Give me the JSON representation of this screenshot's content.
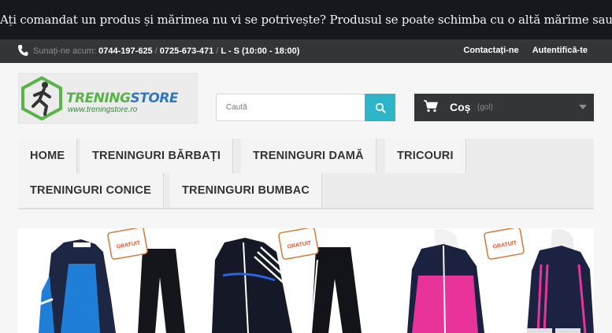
{
  "banner": {
    "text": "Ați comandat un produs și mărimea nu vi se potrivește? Produsul se poate schimba cu o altă mărime sau orice alt produs din stoc!"
  },
  "topbar": {
    "call_label": "Sunați-ne acum:",
    "phone1": "0744-197-625",
    "phone2": "0725-673-471",
    "hours": "L - S (10:00 - 18:00)",
    "links": [
      "Contactați-ne",
      "Autentifică-te"
    ]
  },
  "logo": {
    "brand_a": "TRENING",
    "brand_b": "STORE",
    "url": "www.treningstore.ro"
  },
  "search": {
    "placeholder": "Caută"
  },
  "cart": {
    "label": "Coș",
    "status": "(gol)"
  },
  "nav": {
    "items": [
      "HOME",
      "TRENINGURI BĂRBAȚI",
      "TRENINGURI DAMĂ",
      "TRICOURI",
      "TRENINGURI CONICE",
      "TRENINGURI BUMBAC"
    ]
  },
  "slider": {
    "badge_text": "GRATUIT",
    "badge_top": "TRANSPORT"
  },
  "colors": {
    "accent": "#2fb5c8",
    "dark": "#333539",
    "banner": "#15181d",
    "logo_green": "#58b447",
    "logo_blue": "#2f78c1"
  }
}
